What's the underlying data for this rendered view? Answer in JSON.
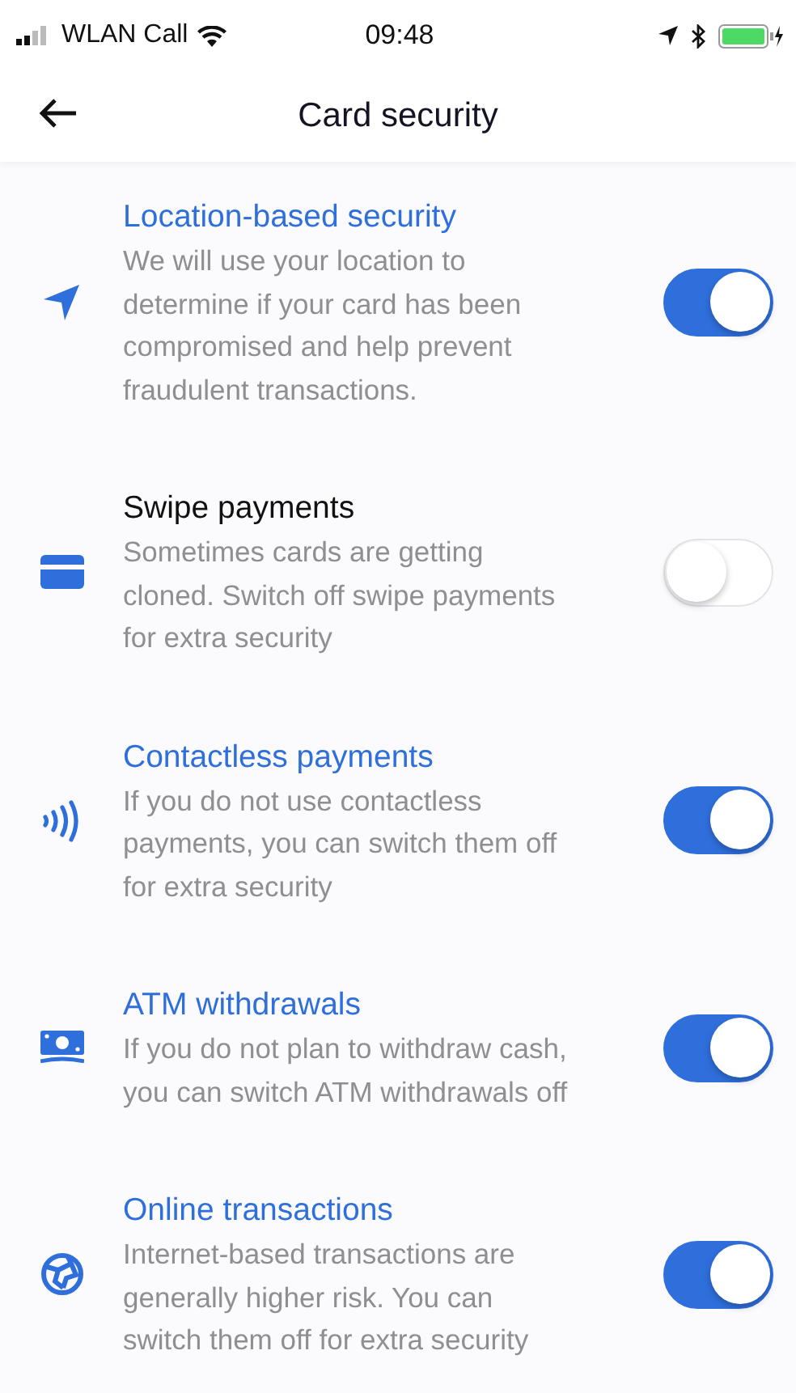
{
  "status_bar": {
    "carrier": "WLAN Call",
    "time": "09:48"
  },
  "nav": {
    "title": "Card security"
  },
  "settings": [
    {
      "title": "Location-based security",
      "description": "We will use your location to determine if your card has been compromised and help prevent fraudulent transactions.",
      "on": true
    },
    {
      "title": "Swipe payments",
      "description": "Sometimes cards are getting cloned. Switch off swipe payments for extra security",
      "on": false
    },
    {
      "title": "Contactless payments",
      "description": "If you do not use contactless payments, you can switch them off for extra security",
      "on": true
    },
    {
      "title": "ATM withdrawals",
      "description": "If you do not plan to withdraw cash, you can switch ATM withdrawals off",
      "on": true
    },
    {
      "title": "Online transactions",
      "description": "Internet-based transactions are generally higher risk. You can switch them off for extra security",
      "on": true
    }
  ]
}
